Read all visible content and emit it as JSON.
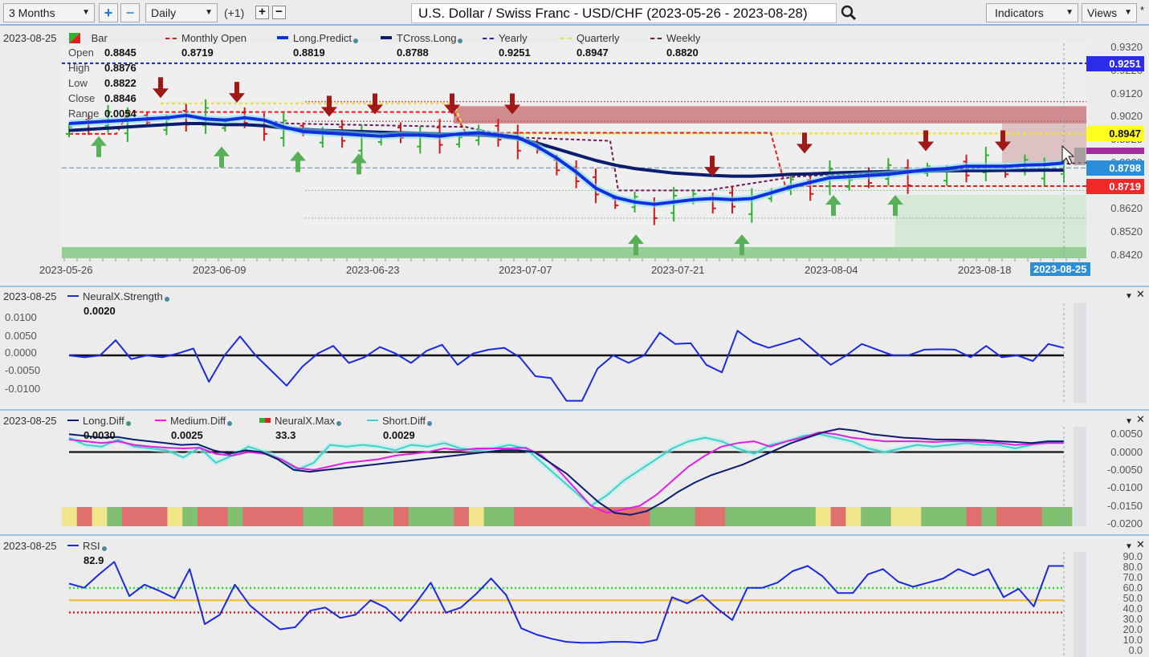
{
  "toolbar": {
    "range_select": "3 Months",
    "interval_select": "Daily",
    "interval_offset": "(+1)",
    "title": "U.S. Dollar / Swiss Franc - USD/CHF (2023-05-26 - 2023-08-28)",
    "indicators_label": "Indicators",
    "views_label": "Views",
    "star": "*"
  },
  "icons": {
    "zoom_in": "+",
    "zoom_out": "−",
    "add": "+",
    "remove": "−",
    "search": "search-icon",
    "dropdown": "▼",
    "close": "✕",
    "pane_menu": "▼"
  },
  "main_pane": {
    "date": "2023-08-25",
    "bar_label": "Bar",
    "ohlc": [
      {
        "label": "Open",
        "value": "0.8845"
      },
      {
        "label": "High",
        "value": "0.8876"
      },
      {
        "label": "Low",
        "value": "0.8822"
      },
      {
        "label": "Close",
        "value": "0.8846"
      },
      {
        "label": "Range",
        "value": "0.0054"
      }
    ],
    "legend": [
      {
        "name": "Monthly Open",
        "value": "0.8719",
        "color": "#e02020",
        "style": "dash"
      },
      {
        "name": "Long.Predict",
        "value": "0.8819",
        "color": "#1030e0",
        "style": "thick"
      },
      {
        "name": "TCross.Long",
        "value": "0.8788",
        "color": "#0b1e6e",
        "style": "thick"
      },
      {
        "name": "Yearly",
        "value": "0.9251",
        "color": "#2020c0",
        "style": "dash"
      },
      {
        "name": "Quarterly",
        "value": "0.8947",
        "color": "#f0e040",
        "style": "dash"
      },
      {
        "name": "Weekly",
        "value": "0.8820",
        "color": "#6a1a5a",
        "style": "dash"
      }
    ],
    "y_ticks": [
      "0.9320",
      "0.9220",
      "0.9120",
      "0.9020",
      "0.8920",
      "0.8820",
      "0.8720",
      "0.8620",
      "0.8520",
      "0.8420"
    ],
    "price_tags": [
      {
        "value": "0.9251",
        "bg": "#2b2be8",
        "fg": "#ffffff"
      },
      {
        "value": "0.8947",
        "bg": "#ffff20",
        "fg": "#111111"
      },
      {
        "value": "0.8798",
        "bg": "#2a8fd8",
        "fg": "#ffffff"
      },
      {
        "value": "0.8719",
        "bg": "#f02828",
        "fg": "#ffffff"
      }
    ],
    "x_ticks": [
      "2023-05-26",
      "2023-06-09",
      "2023-06-23",
      "2023-07-07",
      "2023-07-21",
      "2023-08-04",
      "2023-08-18"
    ],
    "x_current": "2023-08-25"
  },
  "strength_pane": {
    "date": "2023-08-25",
    "legend": [
      {
        "name": "NeuralX.Strength",
        "value": "0.0020",
        "color": "#1a2adc"
      }
    ],
    "y_ticks": [
      "0.0100",
      "0.0050",
      "0.0000",
      "-0.0050",
      "-0.0100"
    ]
  },
  "diff_pane": {
    "date": "2023-08-25",
    "legend": [
      {
        "name": "Long.Diff",
        "value": "0.0030",
        "color": "#0b1e6e"
      },
      {
        "name": "Medium.Diff",
        "value": "0.0025",
        "color": "#e020e0"
      },
      {
        "name": "NeuralX.Max",
        "value": "33.3",
        "color": "#e02020"
      },
      {
        "name": "Short.Diff",
        "value": "0.0029",
        "color": "#40d0c8"
      }
    ],
    "y_ticks": [
      "0.0050",
      "0.0000",
      "-0.0050",
      "-0.0100",
      "-0.0150",
      "-0.0200"
    ]
  },
  "rsi_pane": {
    "date": "2023-08-25",
    "legend": [
      {
        "name": "RSI",
        "value": "82.9",
        "color": "#1a2adc"
      }
    ],
    "y_ticks": [
      "90.0",
      "80.0",
      "70.0",
      "60.0",
      "50.0",
      "40.0",
      "30.0",
      "20.0",
      "10.0",
      "0.0"
    ]
  },
  "chart_data": [
    {
      "type": "line",
      "title": "U.S. Dollar / Swiss Franc - USD/CHF (2023-05-26 - 2023-08-28)",
      "pane": "price",
      "ylim": [
        0.842,
        0.932
      ],
      "x_ticks": [
        "2023-05-26",
        "2023-06-09",
        "2023-06-23",
        "2023-07-07",
        "2023-07-21",
        "2023-08-04",
        "2023-08-18",
        "2023-08-25"
      ],
      "series": [
        {
          "name": "Long.Predict",
          "values": [
            0.899,
            0.8995,
            0.9,
            0.9005,
            0.901,
            0.9015,
            0.9025,
            0.901,
            0.9005,
            0.9015,
            0.9005,
            0.8975,
            0.8955,
            0.895,
            0.8945,
            0.894,
            0.8935,
            0.894,
            0.894,
            0.8935,
            0.8945,
            0.895,
            0.894,
            0.893,
            0.889,
            0.884,
            0.878,
            0.871,
            0.867,
            0.865,
            0.864,
            0.865,
            0.866,
            0.8665,
            0.866,
            0.8665,
            0.869,
            0.8715,
            0.8735,
            0.8755,
            0.876,
            0.8765,
            0.877,
            0.878,
            0.879,
            0.8795,
            0.8805,
            0.8805,
            0.8805,
            0.881,
            0.8812,
            0.8819
          ]
        },
        {
          "name": "TCross.Long",
          "values": [
            0.896,
            0.8965,
            0.897,
            0.8975,
            0.898,
            0.8985,
            0.899,
            0.899,
            0.8985,
            0.8985,
            0.898,
            0.897,
            0.8965,
            0.896,
            0.8958,
            0.8955,
            0.8952,
            0.895,
            0.8948,
            0.8945,
            0.8942,
            0.894,
            0.8935,
            0.8925,
            0.8905,
            0.888,
            0.8855,
            0.883,
            0.881,
            0.8795,
            0.8785,
            0.8775,
            0.877,
            0.8765,
            0.8762,
            0.8762,
            0.8765,
            0.877,
            0.8772,
            0.8775,
            0.8778,
            0.878,
            0.8782,
            0.8783,
            0.8784,
            0.8785,
            0.8786,
            0.8786,
            0.8787,
            0.8787,
            0.8788,
            0.8788
          ]
        },
        {
          "name": "Yearly",
          "values": [
            0.9251
          ]
        },
        {
          "name": "Quarterly",
          "values": [
            0.9077,
            0.8947
          ]
        },
        {
          "name": "Monthly Open",
          "values": [
            0.89,
            0.904,
            0.893,
            0.8719
          ]
        },
        {
          "name": "Weekly",
          "values": [
            0.882
          ]
        }
      ]
    },
    {
      "type": "line",
      "pane": "NeuralX.Strength",
      "ylim": [
        -0.0125,
        0.0125
      ],
      "series": [
        {
          "name": "NeuralX.Strength",
          "values": [
            0.0,
            -0.0005,
            0.0,
            0.004,
            -0.001,
            0.0,
            -0.0005,
            0.0005,
            0.0018,
            -0.007,
            0.0,
            0.005,
            0.0,
            -0.004,
            -0.008,
            -0.003,
            0.0005,
            0.0025,
            -0.002,
            -0.0005,
            0.0022,
            0.0005,
            -0.002,
            0.0012,
            0.0028,
            -0.0025,
            0.0005,
            0.0015,
            0.002,
            -0.0005,
            -0.0055,
            -0.006,
            -0.012,
            -0.012,
            -0.0035,
            0.0,
            -0.002,
            0.0,
            0.006,
            0.003,
            0.0032,
            -0.0025,
            -0.0045,
            0.0065,
            0.0035,
            0.002,
            0.0032,
            0.0045,
            0.001,
            -0.0025,
            0.0,
            0.003,
            0.0015,
            0.0,
            0.0,
            0.0015,
            0.0016,
            0.0015,
            -0.0005,
            0.0025,
            -0.0005,
            0.0,
            -0.0015,
            0.003,
            0.002
          ]
        }
      ]
    },
    {
      "type": "line",
      "pane": "Diff",
      "ylim": [
        -0.0225,
        0.0075
      ],
      "series": [
        {
          "name": "Long.Diff",
          "values": [
            0.005,
            0.0045,
            0.004,
            0.0042,
            0.0035,
            0.003,
            0.0025,
            0.002,
            0.0022,
            0.0005,
            -0.0005,
            0.0005,
            0.0,
            -0.002,
            -0.005,
            -0.0055,
            -0.005,
            -0.0045,
            -0.004,
            -0.0035,
            -0.003,
            -0.0025,
            -0.002,
            -0.0015,
            -0.001,
            -0.0005,
            0.0,
            0.0005,
            0.0005,
            0.0,
            -0.003,
            -0.006,
            -0.01,
            -0.014,
            -0.017,
            -0.0175,
            -0.0165,
            -0.014,
            -0.011,
            -0.0085,
            -0.0065,
            -0.005,
            -0.0035,
            -0.0015,
            0.0005,
            0.0025,
            0.004,
            0.0055,
            0.0065,
            0.006,
            0.005,
            0.0045,
            0.004,
            0.0038,
            0.0035,
            0.0035,
            0.0034,
            0.0033,
            0.003,
            0.0028,
            0.0025,
            0.003,
            0.003
          ]
        },
        {
          "name": "Medium.Diff",
          "values": [
            0.0035,
            0.003,
            0.0025,
            0.003,
            0.002,
            0.0015,
            0.0012,
            0.001,
            0.0012,
            -0.0005,
            -0.001,
            0.0,
            -0.0005,
            -0.002,
            -0.0045,
            -0.005,
            -0.004,
            -0.003,
            -0.0025,
            -0.002,
            -0.001,
            -0.0005,
            0.0,
            0.001,
            0.0005,
            0.001,
            0.001,
            0.001,
            0.0012,
            -0.001,
            -0.005,
            -0.01,
            -0.015,
            -0.017,
            -0.016,
            -0.015,
            -0.012,
            -0.008,
            -0.004,
            -0.001,
            0.0015,
            0.0025,
            0.003,
            0.0015,
            0.003,
            0.004,
            0.0055,
            0.005,
            0.004,
            0.0035,
            0.003,
            0.003,
            0.003,
            0.0028,
            0.003,
            0.003,
            0.0028,
            0.0025,
            0.002,
            0.0022,
            0.0025,
            0.0025
          ]
        },
        {
          "name": "Short.Diff",
          "values": [
            0.004,
            0.002,
            0.0015,
            0.0035,
            0.0015,
            0.001,
            0.0005,
            -0.0015,
            0.0012,
            -0.003,
            -0.001,
            0.0015,
            0.0,
            -0.002,
            -0.005,
            -0.003,
            0.002,
            0.0015,
            0.002,
            0.0015,
            0.0005,
            0.002,
            0.0015,
            0.0025,
            0.001,
            0.0005,
            0.001,
            0.002,
            0.001,
            -0.003,
            -0.007,
            -0.011,
            -0.015,
            -0.012,
            -0.008,
            -0.005,
            -0.002,
            0.001,
            0.003,
            0.004,
            0.003,
            0.001,
            -0.0005,
            0.002,
            0.003,
            0.0045,
            0.005,
            0.004,
            0.003,
            0.001,
            0.0,
            0.001,
            0.002,
            0.0015,
            0.002,
            0.0025,
            0.002,
            0.002,
            0.001,
            0.002,
            0.0029,
            0.0029
          ]
        }
      ],
      "neuralx_max_blocks": [
        "yellow",
        "red",
        "yellow",
        "green",
        "red",
        "red",
        "red",
        "yellow",
        "green",
        "red",
        "red",
        "green",
        "red",
        "red",
        "red",
        "red",
        "green",
        "green",
        "red",
        "red",
        "green",
        "green",
        "red",
        "green",
        "green",
        "green",
        "red",
        "yellow",
        "green",
        "green",
        "red",
        "red",
        "red",
        "red",
        "red",
        "red",
        "red",
        "red",
        "red",
        "green",
        "green",
        "green",
        "red",
        "red",
        "green",
        "green",
        "green",
        "green",
        "green",
        "green",
        "yellow",
        "red",
        "yellow",
        "green",
        "green",
        "yellow",
        "yellow",
        "green",
        "green",
        "green",
        "red",
        "green",
        "red",
        "red",
        "red",
        "green",
        "green"
      ]
    },
    {
      "type": "line",
      "pane": "RSI",
      "ylim": [
        0,
        95
      ],
      "reference_lines": [
        {
          "value": 61.8,
          "color": "#30e030"
        },
        {
          "value": 50,
          "color": "#f0c050"
        },
        {
          "value": 38.2,
          "color": "#e02020"
        }
      ],
      "series": [
        {
          "name": "RSI",
          "values": [
            66,
            62,
            75,
            87,
            54,
            65,
            59,
            52,
            80,
            27,
            36,
            65,
            45,
            33,
            22,
            24,
            40,
            43,
            33,
            36,
            50,
            43,
            30,
            47,
            67,
            38,
            43,
            56,
            71,
            55,
            23,
            17,
            13,
            10,
            9,
            9,
            10,
            10,
            9,
            12,
            53,
            47,
            55,
            42,
            31,
            62,
            62,
            67,
            78,
            83,
            73,
            57,
            57,
            75,
            80,
            68,
            63,
            67,
            71,
            80,
            74,
            80,
            53,
            61,
            44,
            83,
            83
          ]
        }
      ]
    }
  ]
}
